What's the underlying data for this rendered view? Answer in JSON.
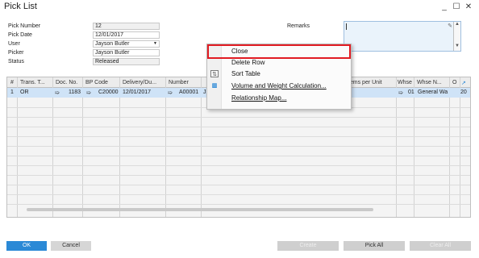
{
  "window": {
    "title": "Pick List",
    "minimize": "_",
    "maximize": "☐",
    "close": "✕"
  },
  "header": {
    "pick_number_label": "Pick Number",
    "pick_number": "12",
    "pick_date_label": "Pick Date",
    "pick_date": "12/01/2017",
    "user_label": "User",
    "user": "Jayson Butler",
    "picker_label": "Picker",
    "picker": "Jayson Butler",
    "status_label": "Status",
    "status": "Released",
    "remarks_label": "Remarks",
    "remarks": ""
  },
  "grid": {
    "columns": [
      "#",
      "Trans. T...",
      "Doc. No.",
      "BP Code",
      "Delivery/Du...",
      "Number",
      "Items per Unit",
      "Whse",
      "Whse N...",
      "O"
    ],
    "row": {
      "num": "1",
      "trans_type": "OR",
      "doc_no": "1183",
      "bp_code": "C20000",
      "delivery": "12/01/2017",
      "number": "A00001",
      "number_tail": "J",
      "whse": "01",
      "whse_name": "General Wa",
      "o": "20"
    }
  },
  "context_menu": {
    "items": [
      "Close",
      "Delete Row",
      "Sort Table",
      "Volume and Weight Calculation...",
      "Relationship Map..."
    ],
    "highlighted": "Close"
  },
  "buttons": {
    "ok": "OK",
    "cancel": "Cancel",
    "create": "Create",
    "pick_all": "Pick All",
    "clear_all": "Clear All"
  },
  "colors": {
    "accent": "#2b89d6",
    "highlight_border": "#e11b22",
    "selected_row": "#cfe3f7",
    "link_arrow": "#e8a000"
  }
}
